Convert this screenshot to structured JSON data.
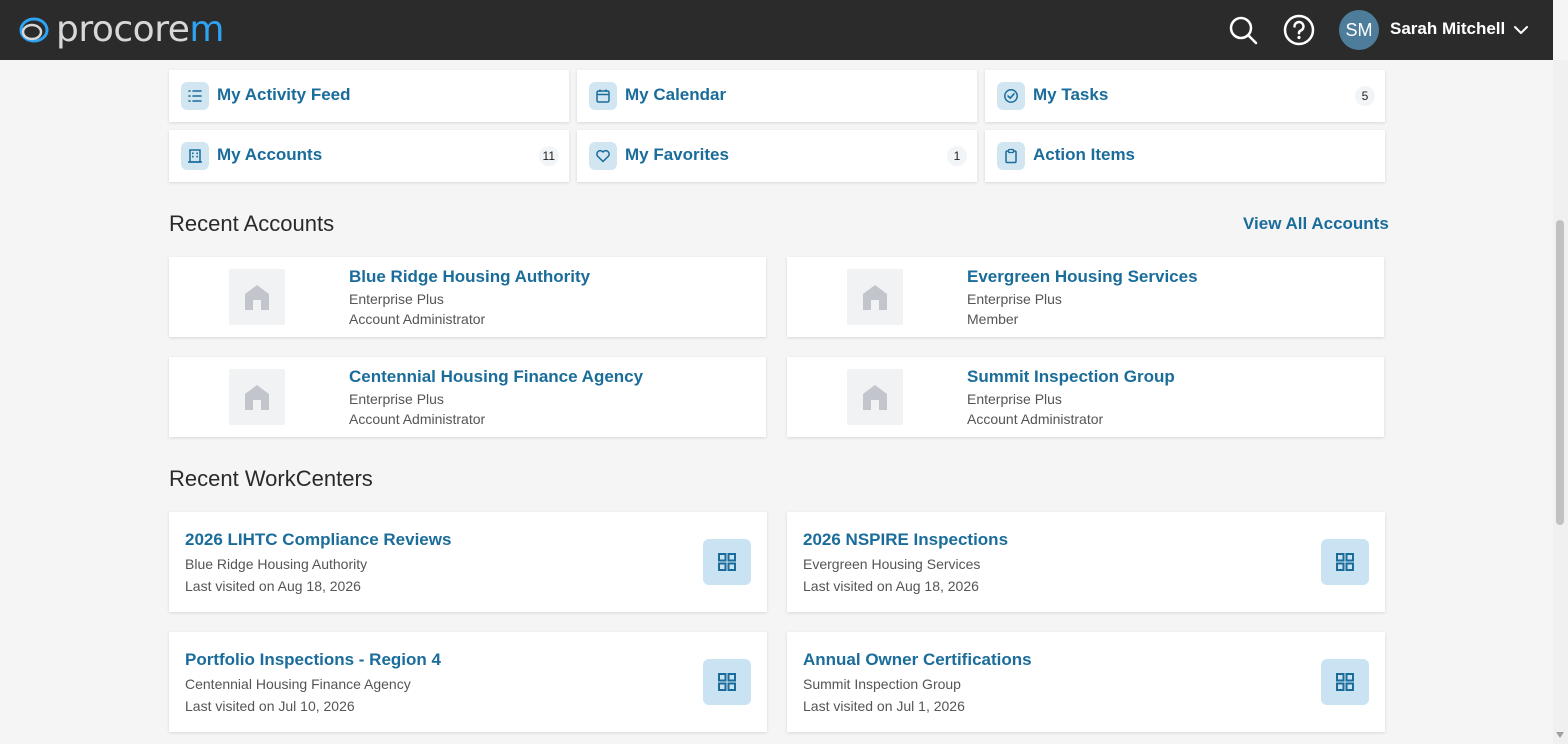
{
  "header": {
    "logo_text_main": "procore",
    "logo_text_accent": "m",
    "search_icon": "search-icon",
    "help_icon": "help-circle-icon",
    "user": {
      "initials": "SM",
      "name": "Sarah Mitchell"
    }
  },
  "quick_links": [
    {
      "label": "My Activity Feed",
      "icon": "list-icon",
      "badge": ""
    },
    {
      "label": "My Calendar",
      "icon": "calendar-icon",
      "badge": ""
    },
    {
      "label": "My Tasks",
      "icon": "check-circle-icon",
      "badge": "5"
    },
    {
      "label": "My Accounts",
      "icon": "building-icon",
      "badge": "11"
    },
    {
      "label": "My Favorites",
      "icon": "heart-icon",
      "badge": "1"
    },
    {
      "label": "Action Items",
      "icon": "clipboard-icon",
      "badge": ""
    }
  ],
  "recent_accounts": {
    "title": "Recent Accounts",
    "view_all": "View All Accounts",
    "items": [
      {
        "name": "Blue Ridge Housing Authority",
        "plan": "Enterprise Plus",
        "role": "Account Administrator"
      },
      {
        "name": "Evergreen Housing Services",
        "plan": "Enterprise Plus",
        "role": "Member"
      },
      {
        "name": "Centennial Housing Finance Agency",
        "plan": "Enterprise Plus",
        "role": "Account Administrator"
      },
      {
        "name": "Summit Inspection Group",
        "plan": "Enterprise Plus",
        "role": "Account Administrator"
      }
    ]
  },
  "recent_workcenters": {
    "title": "Recent WorkCenters",
    "items": [
      {
        "name": "2026 LIHTC Compliance Reviews",
        "account": "Blue Ridge Housing Authority",
        "visited": "Last visited on Aug 18, 2026"
      },
      {
        "name": "2026 NSPIRE Inspections",
        "account": "Evergreen Housing Services",
        "visited": "Last visited on Aug 18, 2026"
      },
      {
        "name": "Portfolio Inspections - Region 4",
        "account": "Centennial Housing Finance Agency",
        "visited": "Last visited on Jul 10, 2026"
      },
      {
        "name": "Annual Owner Certifications",
        "account": "Summit Inspection Group",
        "visited": "Last visited on Jul 1, 2026"
      }
    ]
  },
  "colors": {
    "header_bg": "#2b2b2b",
    "link_blue": "#1a6c9a",
    "accent_light_blue": "#d2e6f2"
  }
}
